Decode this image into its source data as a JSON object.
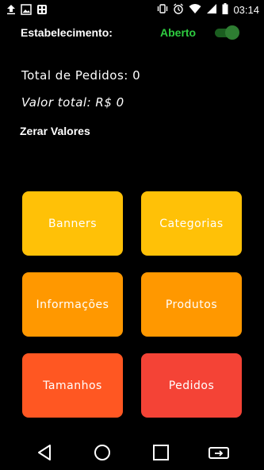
{
  "status_bar": {
    "time": "03:14",
    "left_icons": [
      "upload-icon",
      "image-icon",
      "qr-notification-icon"
    ],
    "right_icons": [
      "vibrate-icon",
      "alarm-icon",
      "wifi-icon",
      "signal-icon",
      "battery-icon"
    ]
  },
  "header": {
    "label": "Estabelecimento:",
    "status": "Aberto",
    "status_color": "#2ecc40",
    "toggle_on": true
  },
  "stats": {
    "total_pedidos": "Total de Pedidos:  0",
    "valor_total": "Valor total: R$  0"
  },
  "actions": {
    "zerar": "Zerar Valores"
  },
  "tiles": [
    {
      "label": "Banners",
      "color": "#ffc107"
    },
    {
      "label": "Categorias",
      "color": "#ffc107"
    },
    {
      "label": "Informações",
      "color": "#ff9800"
    },
    {
      "label": "Produtos",
      "color": "#ff9800"
    },
    {
      "label": "Tamanhos",
      "color": "#ff5722"
    },
    {
      "label": "Pedidos",
      "color": "#f44336"
    }
  ],
  "nav": {
    "icons": [
      "back-icon",
      "home-icon",
      "recents-icon",
      "rotate-icon"
    ]
  }
}
